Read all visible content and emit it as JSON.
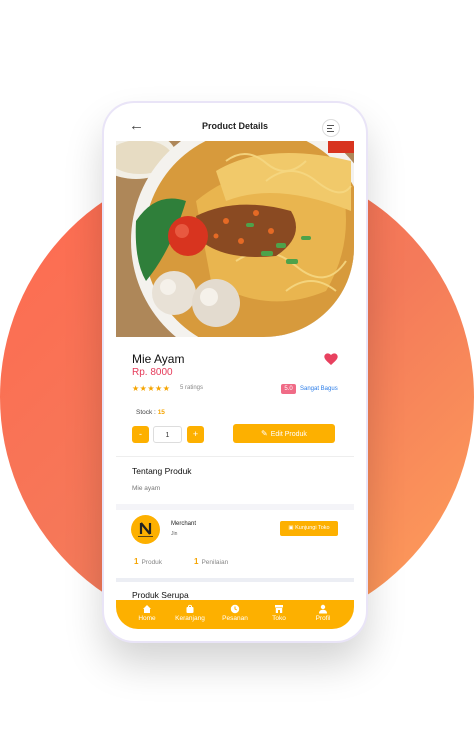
{
  "header": {
    "title": "Product Details",
    "back_icon": "arrow-left-icon",
    "menu_icon": "menu-icon"
  },
  "product": {
    "name": "Mie Ayam",
    "price": "Rp. 8000",
    "rating_stars": 5,
    "ratings_text": "5 ratings",
    "rating_badge": "5.0",
    "rating_label": "Sangat Bagus",
    "stock_label": "Stock :",
    "stock_value": "15",
    "quantity": "1",
    "minus_label": "-",
    "plus_label": "+",
    "edit_label": "Edit Produk"
  },
  "about": {
    "heading": "Tentang Produk",
    "text": "Mie ayam"
  },
  "merchant": {
    "label": "Merchant",
    "name": "Jin",
    "visit_label": "Kunjungi Toko",
    "products_count": "1",
    "products_label": "Produk",
    "reviews_count": "1",
    "reviews_label": "Penilaian"
  },
  "similar": {
    "heading": "Produk Serupa"
  },
  "nav": [
    {
      "label": "Home",
      "icon": "home-icon"
    },
    {
      "label": "Keranjang",
      "icon": "cart-icon"
    },
    {
      "label": "Pesanan",
      "icon": "clock-icon"
    },
    {
      "label": "Toko",
      "icon": "store-icon"
    },
    {
      "label": "Profil",
      "icon": "user-icon"
    }
  ],
  "colors": {
    "accent": "#fdb000",
    "price": "#e53b5a",
    "heart": "#e8415f",
    "link": "#2b7de9"
  }
}
